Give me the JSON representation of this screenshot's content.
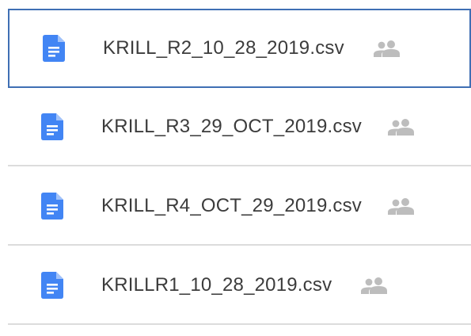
{
  "files": [
    {
      "name": "KRILL_R2_10_28_2019.csv",
      "selected": true,
      "shared": true,
      "icon": "doc-icon"
    },
    {
      "name": "KRILL_R3_29_OCT_2019.csv",
      "selected": false,
      "shared": true,
      "icon": "doc-icon"
    },
    {
      "name": "KRILL_R4_OCT_29_2019.csv",
      "selected": false,
      "shared": true,
      "icon": "doc-icon"
    },
    {
      "name": "KRILLR1_10_28_2019.csv",
      "selected": false,
      "shared": true,
      "icon": "doc-icon"
    }
  ],
  "colors": {
    "doc_icon": "#4285f4",
    "shared_icon": "#bdbdbd",
    "selected_border": "#3f6fb4",
    "divider": "#dcdcdc",
    "text": "#3c3c3c"
  }
}
